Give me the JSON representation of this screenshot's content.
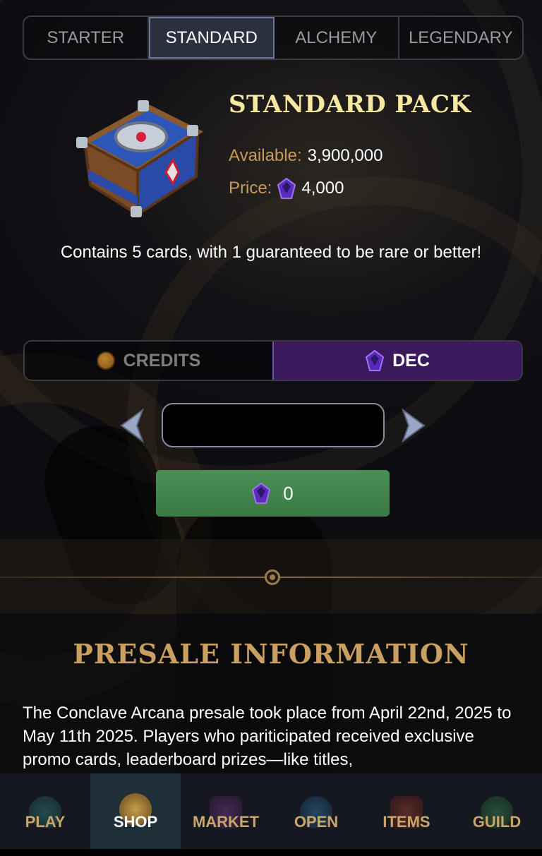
{
  "tabs": [
    {
      "label": "STARTER",
      "active": false
    },
    {
      "label": "STANDARD",
      "active": true
    },
    {
      "label": "ALCHEMY",
      "active": false
    },
    {
      "label": "LEGENDARY",
      "active": false
    }
  ],
  "pack": {
    "title": "STANDARD PACK",
    "available_label": "Available:",
    "available_value": "3,900,000",
    "price_label": "Price:",
    "price_value": "4,000",
    "description": "Contains 5 cards, with 1 guaranteed to be rare or better!",
    "image_icon": "chest-icon"
  },
  "currency": {
    "options": [
      {
        "label": "CREDITS",
        "icon": "coin-icon",
        "selected": false
      },
      {
        "label": "DEC",
        "icon": "gem-icon",
        "selected": true
      }
    ]
  },
  "quantity": {
    "value": "",
    "decrease_icon": "chevron-left-icon",
    "increase_icon": "chevron-right-icon"
  },
  "buy_button": {
    "icon": "gem-icon",
    "amount": "0"
  },
  "presale": {
    "title": "PRESALE INFORMATION",
    "text": "The Conclave Arcana presale took place from April 22nd, 2025 to May 11th 2025. Players who pariticipated received exclusive promo cards, leaderboard prizes—like titles,"
  },
  "bottom_nav": [
    {
      "label": "PLAY",
      "active": false,
      "icon": "play-icon"
    },
    {
      "label": "SHOP",
      "active": true,
      "icon": "shop-icon"
    },
    {
      "label": "MARKET",
      "active": false,
      "icon": "market-icon"
    },
    {
      "label": "OPEN",
      "active": false,
      "icon": "open-icon"
    },
    {
      "label": "ITEMS",
      "active": false,
      "icon": "items-icon"
    },
    {
      "label": "GUILD",
      "active": false,
      "icon": "guild-icon"
    }
  ],
  "colors": {
    "gold_title": "#f6e7a1",
    "label_orange": "#c99a5a",
    "presale_title": "#c9a062",
    "dec_selected_bg": "#3a1a5c",
    "buy_green": "#3f8049"
  }
}
